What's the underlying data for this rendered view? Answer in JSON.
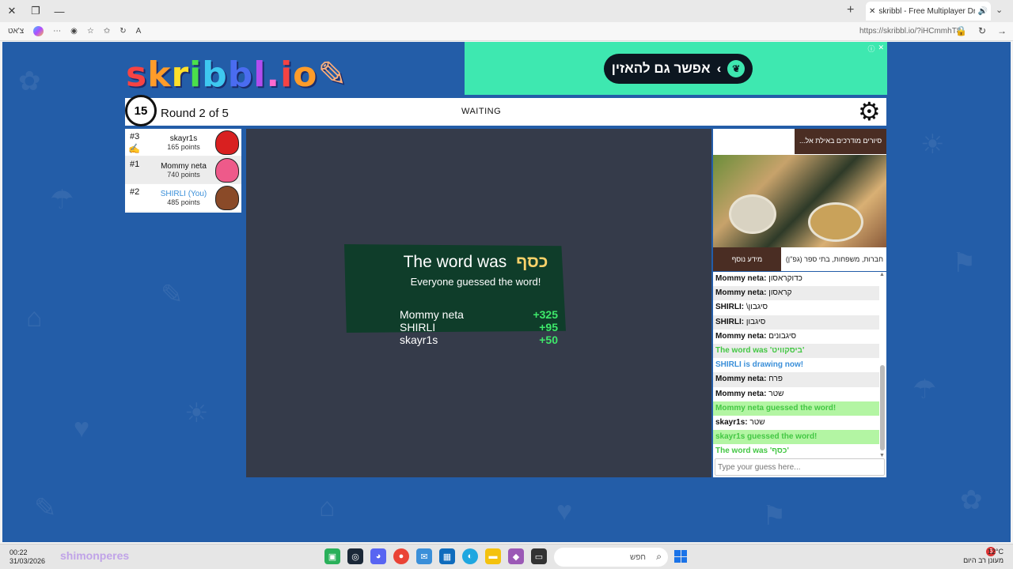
{
  "browser": {
    "tab_title": "skribbl - Free Multiplayer Dra...",
    "url": "https://skribbl.io/?iHCmmhT8",
    "left_label": "צ'אט"
  },
  "logo": "skribbl.io",
  "ad_top": {
    "label": "אפשר גם להאזין"
  },
  "game": {
    "timer": "15",
    "round": "Round 2 of 5",
    "status": "WAITING"
  },
  "players": [
    {
      "rank": "#3",
      "name": "skayr1s",
      "points": "165 points",
      "color": "#d92020"
    },
    {
      "rank": "#1",
      "name": "Mommy neta",
      "points": "740 points",
      "color": "#ee5a8a"
    },
    {
      "rank": "#2",
      "name": "SHIRLI (You)",
      "points": "485 points",
      "color": "#8a4a28"
    }
  ],
  "overlay": {
    "title": "The word was",
    "word": "כסף",
    "subtitle": "Everyone guessed the word!",
    "scores": [
      {
        "name": "Mommy neta",
        "points": "+325"
      },
      {
        "name": "SHIRLI",
        "points": "+95"
      },
      {
        "name": "skayr1s",
        "points": "+50"
      }
    ]
  },
  "ad_side": {
    "top_text": "...סיורים מודרכים באילת אל",
    "bottom_text": "חברות, משפחות, בתי ספר (גפ\"ן)",
    "button": "מידע נוסף"
  },
  "chat": {
    "messages": [
      {
        "name": "Mommy neta:",
        "text": "כדוקראסון"
      },
      {
        "name": "Mommy neta:",
        "text": "קראסון"
      },
      {
        "name": "SHIRLI:",
        "text": "\\סיגבון"
      },
      {
        "name": "SHIRLI:",
        "text": "סיגבון"
      },
      {
        "name": "Mommy neta:",
        "text": "סיגבונים"
      },
      {
        "system": "The word was 'ביסקוויט'"
      },
      {
        "system": "SHIRLI is drawing now!"
      },
      {
        "name": "Mommy neta:",
        "text": "פרח"
      },
      {
        "name": "Mommy neta:",
        "text": "שטר"
      },
      {
        "system": "Mommy neta guessed the word!"
      },
      {
        "name": "skayr1s:",
        "text": "שטר"
      },
      {
        "system": "skayr1s guessed the word!"
      },
      {
        "system": "The word was 'כסף'"
      }
    ],
    "input_placeholder": "Type your guess here..."
  },
  "taskbar": {
    "time": "00:22",
    "date": "31/03/2026",
    "watermark": "shimonperes",
    "search_placeholder": "חפש",
    "temperature": "12°C",
    "weather": "מעונן רב היום",
    "notifications": "3"
  }
}
